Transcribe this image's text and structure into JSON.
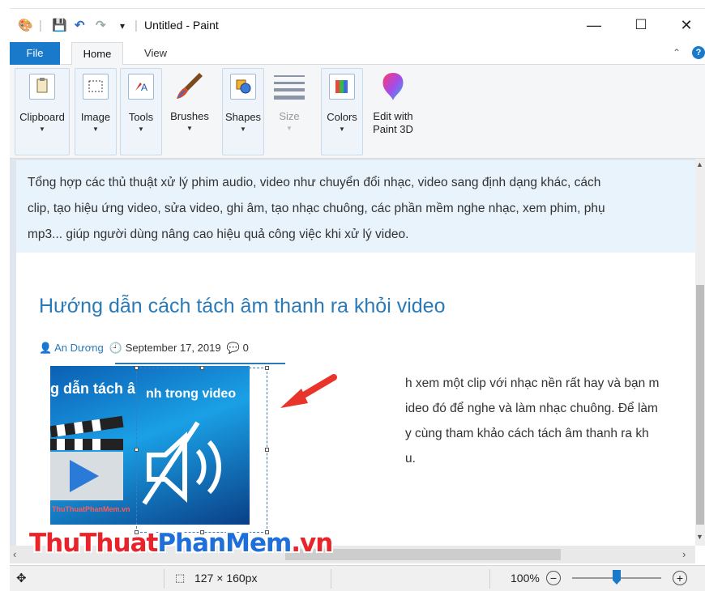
{
  "titlebar": {
    "title": "Untitled - Paint",
    "minimize": "—",
    "maximize": "☐",
    "close": "✕"
  },
  "ribbon_tabs": {
    "file": "File",
    "home": "Home",
    "view": "View"
  },
  "ribbon_groups": {
    "clipboard": "Clipboard",
    "image": "Image",
    "tools": "Tools",
    "brushes": "Brushes",
    "shapes": "Shapes",
    "size": "Size",
    "colors": "Colors",
    "paint3d_line1": "Edit with",
    "paint3d_line2": "Paint 3D"
  },
  "canvas": {
    "intro_line1": "Tổng hợp các thủ thuật xử lý phim audio, video như chuyển đổi nhạc, video sang định dạng khác, cách",
    "intro_line2": "clip, tạo hiệu ứng video, sửa video, ghi âm, tạo nhạc chuông, các phần mềm nghe nhạc, xem phim, phụ",
    "intro_line3": "mp3... giúp người dùng nâng cao hiệu quả công việc khi xử lý video.",
    "article_title": "Hướng dẫn cách tách âm thanh ra khỏi video",
    "author": "An Dương",
    "date": "September 17, 2019",
    "comments": "0",
    "thumb_caption_left": "g dẫn tách â",
    "thumb_caption_right": "nh trong video",
    "thumb_logo": "ThuThuatPhanMem.vn",
    "body_line1": "h xem một clip với nhạc nền rất hay và bạn m",
    "body_line2": "ideo đó để nghe và làm nhạc chuông. Để làm",
    "body_line3": "y cùng tham khảo cách tách âm thanh ra kh",
    "body_line4": "u."
  },
  "statusbar": {
    "selection_size": "127 × 160px",
    "zoom": "100%",
    "zoom_level_percent": 100
  },
  "watermark": {
    "part1": "ThuThuat",
    "part2": "PhanMem",
    "part3": ".vn"
  },
  "colors": {
    "accent": "#1979ca",
    "link": "#2b7ab8",
    "arrow": "#e8342a"
  }
}
